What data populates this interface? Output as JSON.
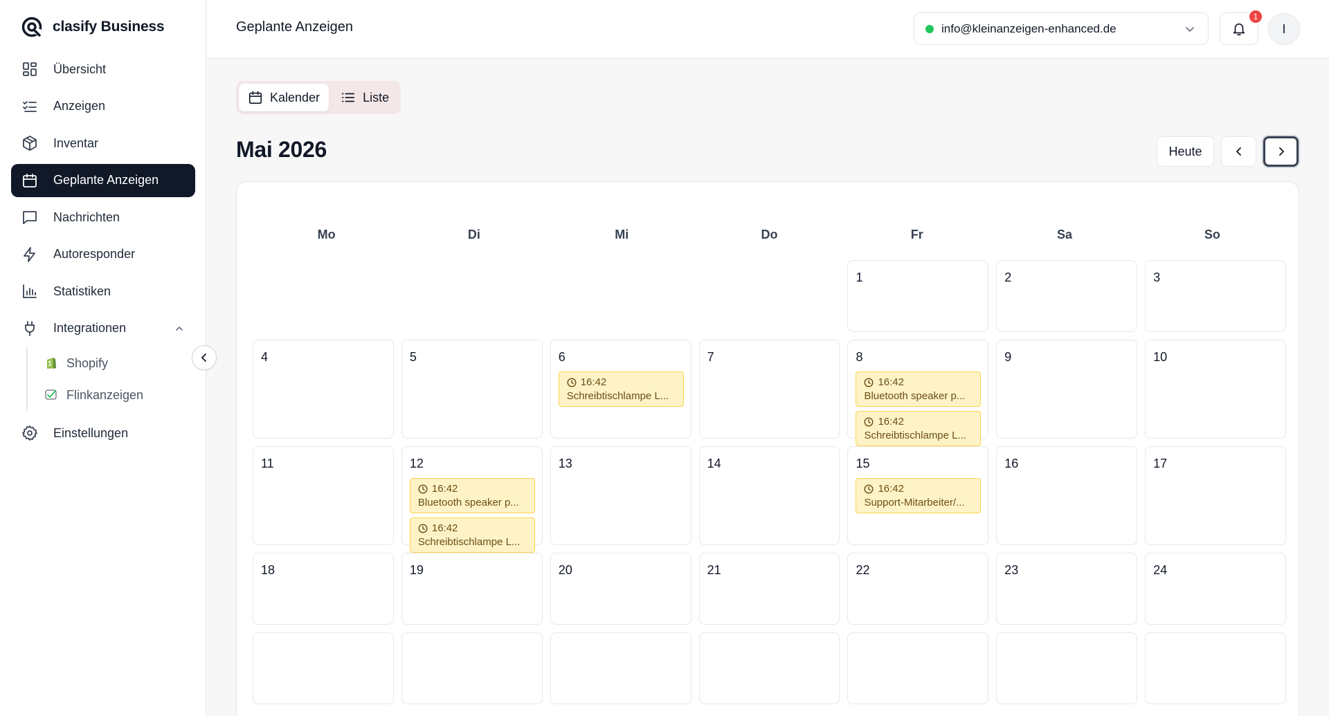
{
  "brand": {
    "name": "clasify Business"
  },
  "sidebar": {
    "items": [
      {
        "label": "Übersicht",
        "icon": "dashboard-icon"
      },
      {
        "label": "Anzeigen",
        "icon": "list-check-icon"
      },
      {
        "label": "Inventar",
        "icon": "box-icon"
      },
      {
        "label": "Geplante Anzeigen",
        "icon": "calendar-icon",
        "active": true
      },
      {
        "label": "Nachrichten",
        "icon": "message-icon"
      },
      {
        "label": "Autoresponder",
        "icon": "bolt-icon"
      },
      {
        "label": "Statistiken",
        "icon": "bar-chart-icon"
      },
      {
        "label": "Integrationen",
        "icon": "plug-icon",
        "expanded": true
      }
    ],
    "sub_items": [
      {
        "label": "Shopify",
        "icon": "shopify-icon"
      },
      {
        "label": "Flinkanzeigen",
        "icon": "flinkanzeigen-icon"
      }
    ],
    "settings": {
      "label": "Einstellungen",
      "icon": "gear-icon"
    }
  },
  "header": {
    "title": "Geplante Anzeigen",
    "account_email": "info@kleinanzeigen-enhanced.de",
    "notification_count": "1",
    "avatar_initial": "I"
  },
  "view_toggle": {
    "calendar": "Kalender",
    "list": "Liste",
    "active": "calendar"
  },
  "calendar": {
    "month_title": "Mai 2026",
    "today_label": "Heute",
    "weekdays": [
      "Mo",
      "Di",
      "Mi",
      "Do",
      "Fr",
      "Sa",
      "So"
    ],
    "weeks": [
      [
        null,
        null,
        null,
        null,
        {
          "day": "1",
          "events": []
        },
        {
          "day": "2",
          "events": []
        },
        {
          "day": "3",
          "events": []
        }
      ],
      [
        {
          "day": "4",
          "events": []
        },
        {
          "day": "5",
          "events": []
        },
        {
          "day": "6",
          "events": [
            {
              "time": "16:42",
              "title": "Schreibtischlampe L..."
            }
          ]
        },
        {
          "day": "7",
          "events": []
        },
        {
          "day": "8",
          "events": [
            {
              "time": "16:42",
              "title": "Bluetooth speaker p..."
            },
            {
              "time": "16:42",
              "title": "Schreibtischlampe L..."
            }
          ]
        },
        {
          "day": "9",
          "events": []
        },
        {
          "day": "10",
          "events": []
        }
      ],
      [
        {
          "day": "11",
          "events": []
        },
        {
          "day": "12",
          "events": [
            {
              "time": "16:42",
              "title": "Bluetooth speaker p..."
            },
            {
              "time": "16:42",
              "title": "Schreibtischlampe L..."
            }
          ]
        },
        {
          "day": "13",
          "events": []
        },
        {
          "day": "14",
          "events": []
        },
        {
          "day": "15",
          "events": [
            {
              "time": "16:42",
              "title": "Support-Mitarbeiter/..."
            }
          ]
        },
        {
          "day": "16",
          "events": []
        },
        {
          "day": "17",
          "events": []
        }
      ],
      [
        {
          "day": "18",
          "events": []
        },
        {
          "day": "19",
          "events": []
        },
        {
          "day": "20",
          "events": []
        },
        {
          "day": "21",
          "events": []
        },
        {
          "day": "22",
          "events": []
        },
        {
          "day": "23",
          "events": []
        },
        {
          "day": "24",
          "events": []
        }
      ],
      [
        {
          "day": "",
          "events": []
        },
        {
          "day": "",
          "events": []
        },
        {
          "day": "",
          "events": []
        },
        {
          "day": "",
          "events": []
        },
        {
          "day": "",
          "events": []
        },
        {
          "day": "",
          "events": []
        },
        {
          "day": "",
          "events": []
        }
      ]
    ]
  },
  "colors": {
    "accent_dark": "#111827",
    "event_bg": "#fef3c7",
    "event_border": "#fcd34d",
    "status_online": "#22c55e",
    "badge": "#ef4444"
  }
}
